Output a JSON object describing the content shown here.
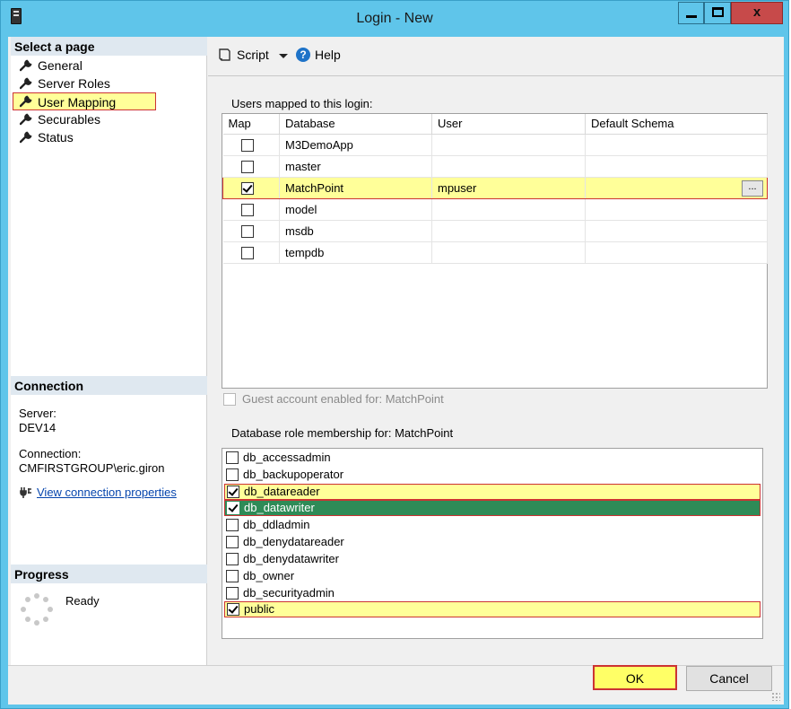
{
  "window": {
    "title": "Login - New",
    "close_glyph": "x"
  },
  "left_pane": {
    "select_page_header": "Select a page",
    "pages": [
      {
        "label": "General",
        "icon": "wrench-icon"
      },
      {
        "label": "Server Roles",
        "icon": "wrench-icon"
      },
      {
        "label": "User Mapping",
        "icon": "wrench-icon",
        "selected": true
      },
      {
        "label": "Securables",
        "icon": "wrench-icon"
      },
      {
        "label": "Status",
        "icon": "wrench-icon"
      }
    ],
    "connection_header": "Connection",
    "server_label": "Server:",
    "server_value": "DEV14",
    "connection_label": "Connection:",
    "connection_value": "CMFIRSTGROUP\\eric.giron",
    "view_connection_link": "View connection properties",
    "progress_header": "Progress",
    "progress_status": "Ready"
  },
  "toolbar": {
    "script_label": "Script",
    "help_label": "Help"
  },
  "users_mapped": {
    "label": "Users mapped to this login:",
    "columns": [
      "Map",
      "Database",
      "User",
      "Default Schema"
    ],
    "rows": [
      {
        "map": false,
        "database": "M3DemoApp",
        "user": "",
        "schema": ""
      },
      {
        "map": false,
        "database": "master",
        "user": "",
        "schema": ""
      },
      {
        "map": true,
        "database": "MatchPoint",
        "user": "mpuser",
        "schema": "",
        "highlighted": true
      },
      {
        "map": false,
        "database": "model",
        "user": "",
        "schema": ""
      },
      {
        "map": false,
        "database": "msdb",
        "user": "",
        "schema": ""
      },
      {
        "map": false,
        "database": "tempdb",
        "user": "",
        "schema": ""
      }
    ],
    "ellipsis_label": "..."
  },
  "guest": {
    "label": "Guest account enabled for: MatchPoint",
    "checked": false
  },
  "roles": {
    "label": "Database role membership for: MatchPoint",
    "items": [
      {
        "name": "db_accessadmin",
        "checked": false
      },
      {
        "name": "db_backupoperator",
        "checked": false
      },
      {
        "name": "db_datareader",
        "checked": true,
        "highlighted": true
      },
      {
        "name": "db_datawriter",
        "checked": true,
        "selected": true
      },
      {
        "name": "db_ddladmin",
        "checked": false
      },
      {
        "name": "db_denydatareader",
        "checked": false
      },
      {
        "name": "db_denydatawriter",
        "checked": false
      },
      {
        "name": "db_owner",
        "checked": false
      },
      {
        "name": "db_securityadmin",
        "checked": false
      },
      {
        "name": "public",
        "checked": true,
        "highlighted": true
      }
    ]
  },
  "buttons": {
    "ok": "OK",
    "cancel": "Cancel"
  },
  "colors": {
    "titlebar": "#5fc5ea",
    "highlight": "#ffff99",
    "highlight_border": "#cc3333",
    "selected_row": "#2e8b57",
    "link": "#0645ad"
  }
}
